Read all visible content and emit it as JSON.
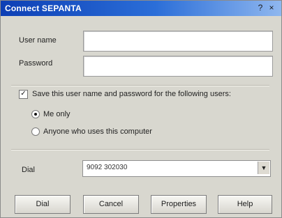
{
  "window": {
    "title": "Connect SEPANTA",
    "help_glyph": "?",
    "close_glyph": "×"
  },
  "fields": {
    "username_label": "User name",
    "username_value": "",
    "password_label": "Password",
    "password_value": ""
  },
  "save_options": {
    "checkbox_checked": true,
    "checkbox_label": "Save this user name and password for the following users:",
    "radio_me_only": "Me only",
    "radio_anyone": "Anyone who uses this computer",
    "selected": "Me only"
  },
  "dial": {
    "label": "Dial",
    "value": "9092 302030"
  },
  "buttons": {
    "dial": "Dial",
    "cancel": "Cancel",
    "properties": "Properties",
    "help": "Help"
  },
  "colors": {
    "titlebar_start": "#0d3fb5",
    "titlebar_end": "#8fb7ef",
    "window_bg": "#d8d7cf"
  }
}
